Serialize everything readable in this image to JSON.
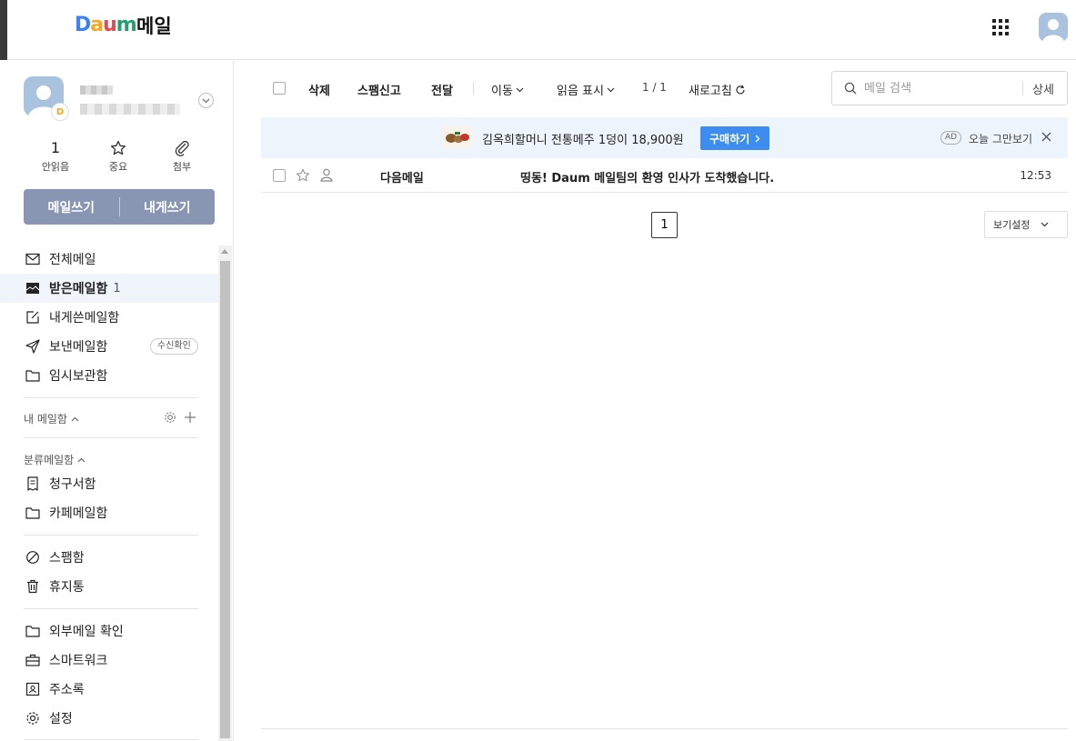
{
  "header": {
    "logo": {
      "d": "D",
      "a": "a",
      "u": "u",
      "m": "m"
    },
    "service_name": "메일",
    "apps_icon": "grid-9-icon",
    "avatar_icon": "user-avatar-icon"
  },
  "profile": {
    "badge": "D",
    "name_blurred": "",
    "email_blurred": ""
  },
  "stats": {
    "unread_count": "1",
    "unread_label": "안읽음",
    "important_label": "중요",
    "attachment_label": "첨부"
  },
  "compose": {
    "write_label": "메일쓰기",
    "self_label": "내게쓰기"
  },
  "nav": {
    "all": "전체메일",
    "inbox": "받은메일함",
    "inbox_count": "1",
    "self": "내게쓴메일함",
    "sent": "보낸메일함",
    "sent_pill": "수신확인",
    "drafts": "임시보관함",
    "my_mailbox": "내 메일함",
    "category_title": "분류메일함",
    "invoices": "청구서함",
    "cafe": "카페메일함",
    "spam": "스팸함",
    "trash": "휴지통",
    "external": "외부메일 확인",
    "smartwork": "스마트워크",
    "contacts": "주소록",
    "settings": "설정"
  },
  "toolbar": {
    "delete": "삭제",
    "spam_report": "스팸신고",
    "forward": "전달",
    "move": "이동",
    "mark_read": "읽음 표시",
    "page_info": "1 / 1",
    "refresh": "새로고침",
    "search_placeholder": "메일 검색",
    "search_detail": "상세"
  },
  "ad": {
    "text": "김옥희할머니 전통메주 1덩이 18,900원",
    "button": "구매하기",
    "tag": "AD",
    "close_text": "오늘 그만보기"
  },
  "mails": [
    {
      "sender": "다음메일",
      "subject": "띵동! Daum 메일팀의 환영 인사가 도착했습니다.",
      "time": "12:53"
    }
  ],
  "pagination": {
    "current": "1"
  },
  "view_settings": "보기설정",
  "colors": {
    "compose_bg": "#8896b3",
    "accent": "#3d8cf0",
    "active_bg": "#f0f4fb",
    "ad_bg": "#eef4fb"
  }
}
